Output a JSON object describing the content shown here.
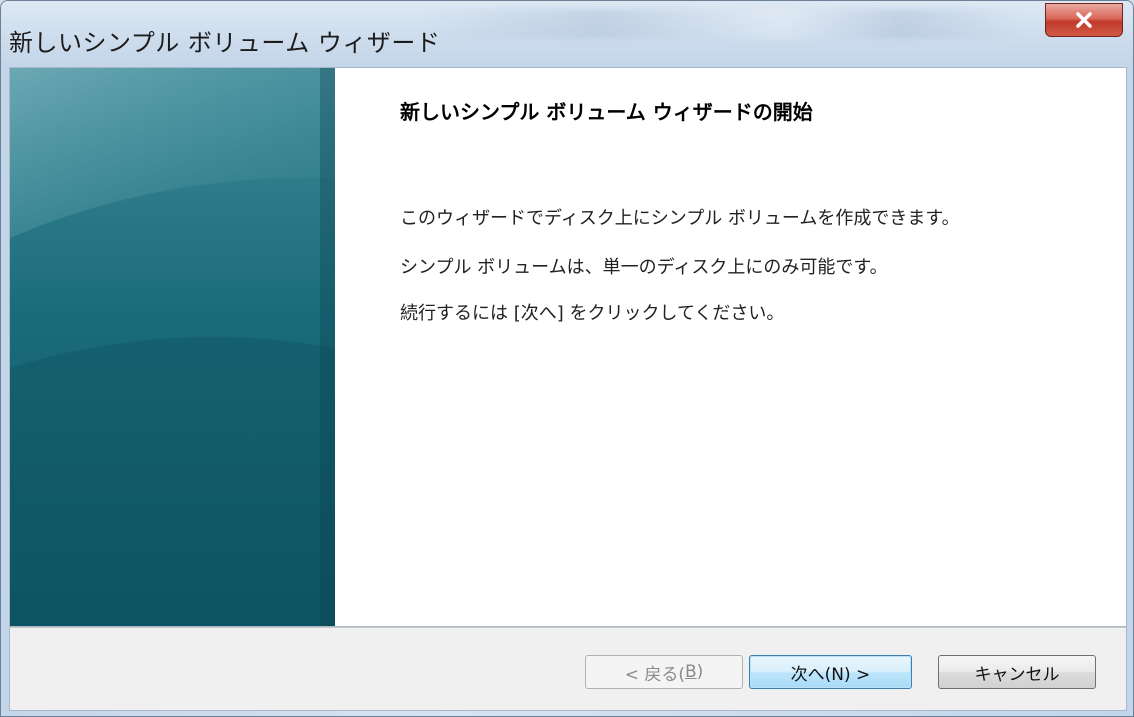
{
  "window": {
    "title": "新しいシンプル ボリューム ウィザード",
    "close_icon": "close-icon",
    "close_color": "#c0392b"
  },
  "main": {
    "heading": "新しいシンプル ボリューム ウィザードの開始",
    "paragraphs": [
      "このウィザードでディスク上にシンプル ボリュームを作成できます。",
      "シンプル ボリュームは、単一のディスク上にのみ可能です。",
      "続行するには [次へ] をクリックしてください。"
    ]
  },
  "buttons": {
    "back_label": "< 戻る(",
    "back_key": "B",
    "back_end": ")",
    "next_label": "次へ(N) >",
    "cancel_label": "キャンセル"
  },
  "colors": {
    "banner_dark": "#0d4a58",
    "banner_light": "#3f8a98"
  }
}
